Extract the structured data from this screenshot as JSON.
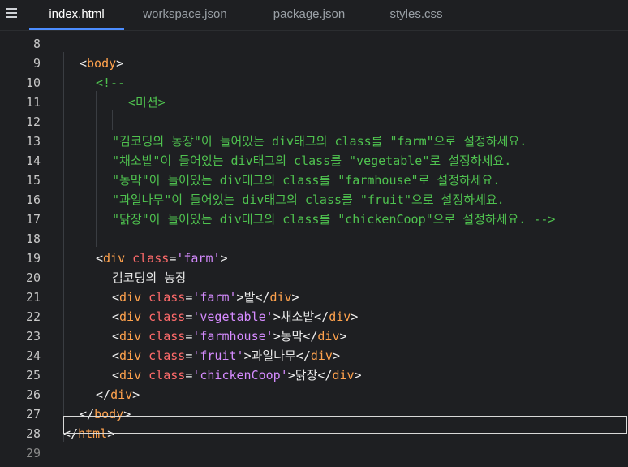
{
  "tabs": [
    {
      "label": "index.html",
      "active": true
    },
    {
      "label": "workspace.json",
      "active": false
    },
    {
      "label": "package.json",
      "active": false
    },
    {
      "label": "styles.css",
      "active": false
    }
  ],
  "colors": {
    "accent": "#4c8dff",
    "tag": "#ffa24d",
    "attr": "#ff6b6b",
    "string": "#d58bff",
    "comment": "#4fc24f"
  },
  "lines": [
    {
      "num": "8",
      "tokens": []
    },
    {
      "num": "9",
      "tokens": [
        {
          "t": "tag",
          "v": "<"
        },
        {
          "t": "name",
          "v": "body"
        },
        {
          "t": "tag",
          "v": ">"
        }
      ]
    },
    {
      "num": "10",
      "tokens": [
        {
          "t": "com",
          "v": "<!--"
        }
      ]
    },
    {
      "num": "11",
      "tokens": [
        {
          "t": "com",
          "v": "<미션>"
        }
      ]
    },
    {
      "num": "12",
      "tokens": []
    },
    {
      "num": "13",
      "tokens": [
        {
          "t": "com",
          "v": "\"김코딩의 농장\"이 들어있는 div태그의 class를 \"farm\"으로 설정하세요."
        }
      ]
    },
    {
      "num": "14",
      "tokens": [
        {
          "t": "com",
          "v": "\"채소밭\"이 들어있는 div태그의 class를 \"vegetable\"로 설정하세요."
        }
      ]
    },
    {
      "num": "15",
      "tokens": [
        {
          "t": "com",
          "v": "\"농막\"이 들어있는 div태그의 class를 \"farmhouse\"로 설정하세요."
        }
      ]
    },
    {
      "num": "16",
      "tokens": [
        {
          "t": "com",
          "v": "\"과일나무\"이 들어있는 div태그의 class를 \"fruit\"으로 설정하세요."
        }
      ]
    },
    {
      "num": "17",
      "tokens": [
        {
          "t": "com",
          "v": "\"닭장\"이 들어있는 div태그의 class를 \"chickenCoop\"으로 설정하세요. -->"
        }
      ]
    },
    {
      "num": "18",
      "tokens": []
    },
    {
      "num": "19",
      "tokens": [
        {
          "t": "tag",
          "v": "<"
        },
        {
          "t": "name",
          "v": "div"
        },
        {
          "t": "txt",
          "v": " "
        },
        {
          "t": "attr",
          "v": "class"
        },
        {
          "t": "tag",
          "v": "="
        },
        {
          "t": "str",
          "v": "'farm'"
        },
        {
          "t": "tag",
          "v": ">"
        }
      ]
    },
    {
      "num": "20",
      "tokens": [
        {
          "t": "txt",
          "v": "김코딩의 농장"
        }
      ]
    },
    {
      "num": "21",
      "tokens": [
        {
          "t": "tag",
          "v": "<"
        },
        {
          "t": "name",
          "v": "div"
        },
        {
          "t": "txt",
          "v": " "
        },
        {
          "t": "attr",
          "v": "class"
        },
        {
          "t": "tag",
          "v": "="
        },
        {
          "t": "str",
          "v": "'farm'"
        },
        {
          "t": "tag",
          "v": ">"
        },
        {
          "t": "txt",
          "v": "밭"
        },
        {
          "t": "tag",
          "v": "</"
        },
        {
          "t": "name",
          "v": "div"
        },
        {
          "t": "tag",
          "v": ">"
        }
      ]
    },
    {
      "num": "22",
      "tokens": [
        {
          "t": "tag",
          "v": "<"
        },
        {
          "t": "name",
          "v": "div"
        },
        {
          "t": "txt",
          "v": " "
        },
        {
          "t": "attr",
          "v": "class"
        },
        {
          "t": "tag",
          "v": "="
        },
        {
          "t": "str",
          "v": "'vegetable'"
        },
        {
          "t": "tag",
          "v": ">"
        },
        {
          "t": "txt",
          "v": "채소밭"
        },
        {
          "t": "tag",
          "v": "</"
        },
        {
          "t": "name",
          "v": "div"
        },
        {
          "t": "tag",
          "v": ">"
        }
      ]
    },
    {
      "num": "23",
      "tokens": [
        {
          "t": "tag",
          "v": "<"
        },
        {
          "t": "name",
          "v": "div"
        },
        {
          "t": "txt",
          "v": " "
        },
        {
          "t": "attr",
          "v": "class"
        },
        {
          "t": "tag",
          "v": "="
        },
        {
          "t": "str",
          "v": "'farmhouse'"
        },
        {
          "t": "tag",
          "v": ">"
        },
        {
          "t": "txt",
          "v": "농막"
        },
        {
          "t": "tag",
          "v": "</"
        },
        {
          "t": "name",
          "v": "div"
        },
        {
          "t": "tag",
          "v": ">"
        }
      ]
    },
    {
      "num": "24",
      "tokens": [
        {
          "t": "tag",
          "v": "<"
        },
        {
          "t": "name",
          "v": "div"
        },
        {
          "t": "txt",
          "v": " "
        },
        {
          "t": "attr",
          "v": "class"
        },
        {
          "t": "tag",
          "v": "="
        },
        {
          "t": "str",
          "v": "'fruit'"
        },
        {
          "t": "tag",
          "v": ">"
        },
        {
          "t": "txt",
          "v": "과일나무"
        },
        {
          "t": "tag",
          "v": "</"
        },
        {
          "t": "name",
          "v": "div"
        },
        {
          "t": "tag",
          "v": ">"
        }
      ]
    },
    {
      "num": "25",
      "tokens": [
        {
          "t": "tag",
          "v": "<"
        },
        {
          "t": "name",
          "v": "div"
        },
        {
          "t": "txt",
          "v": " "
        },
        {
          "t": "attr",
          "v": "class"
        },
        {
          "t": "tag",
          "v": "="
        },
        {
          "t": "str",
          "v": "'chickenCoop'"
        },
        {
          "t": "tag",
          "v": ">"
        },
        {
          "t": "txt",
          "v": "닭장"
        },
        {
          "t": "tag",
          "v": "</"
        },
        {
          "t": "name",
          "v": "div"
        },
        {
          "t": "tag",
          "v": ">"
        }
      ]
    },
    {
      "num": "26",
      "tokens": [
        {
          "t": "tag",
          "v": "</"
        },
        {
          "t": "name",
          "v": "div"
        },
        {
          "t": "tag",
          "v": ">"
        }
      ]
    },
    {
      "num": "27",
      "tokens": [
        {
          "t": "tag",
          "v": "</"
        },
        {
          "t": "name",
          "v": "body"
        },
        {
          "t": "tag",
          "v": ">"
        }
      ]
    },
    {
      "num": "28",
      "tokens": [
        {
          "t": "tag",
          "v": "</"
        },
        {
          "t": "name",
          "v": "html"
        },
        {
          "t": "tag",
          "v": ">"
        }
      ]
    },
    {
      "num": "29",
      "tokens": []
    }
  ]
}
